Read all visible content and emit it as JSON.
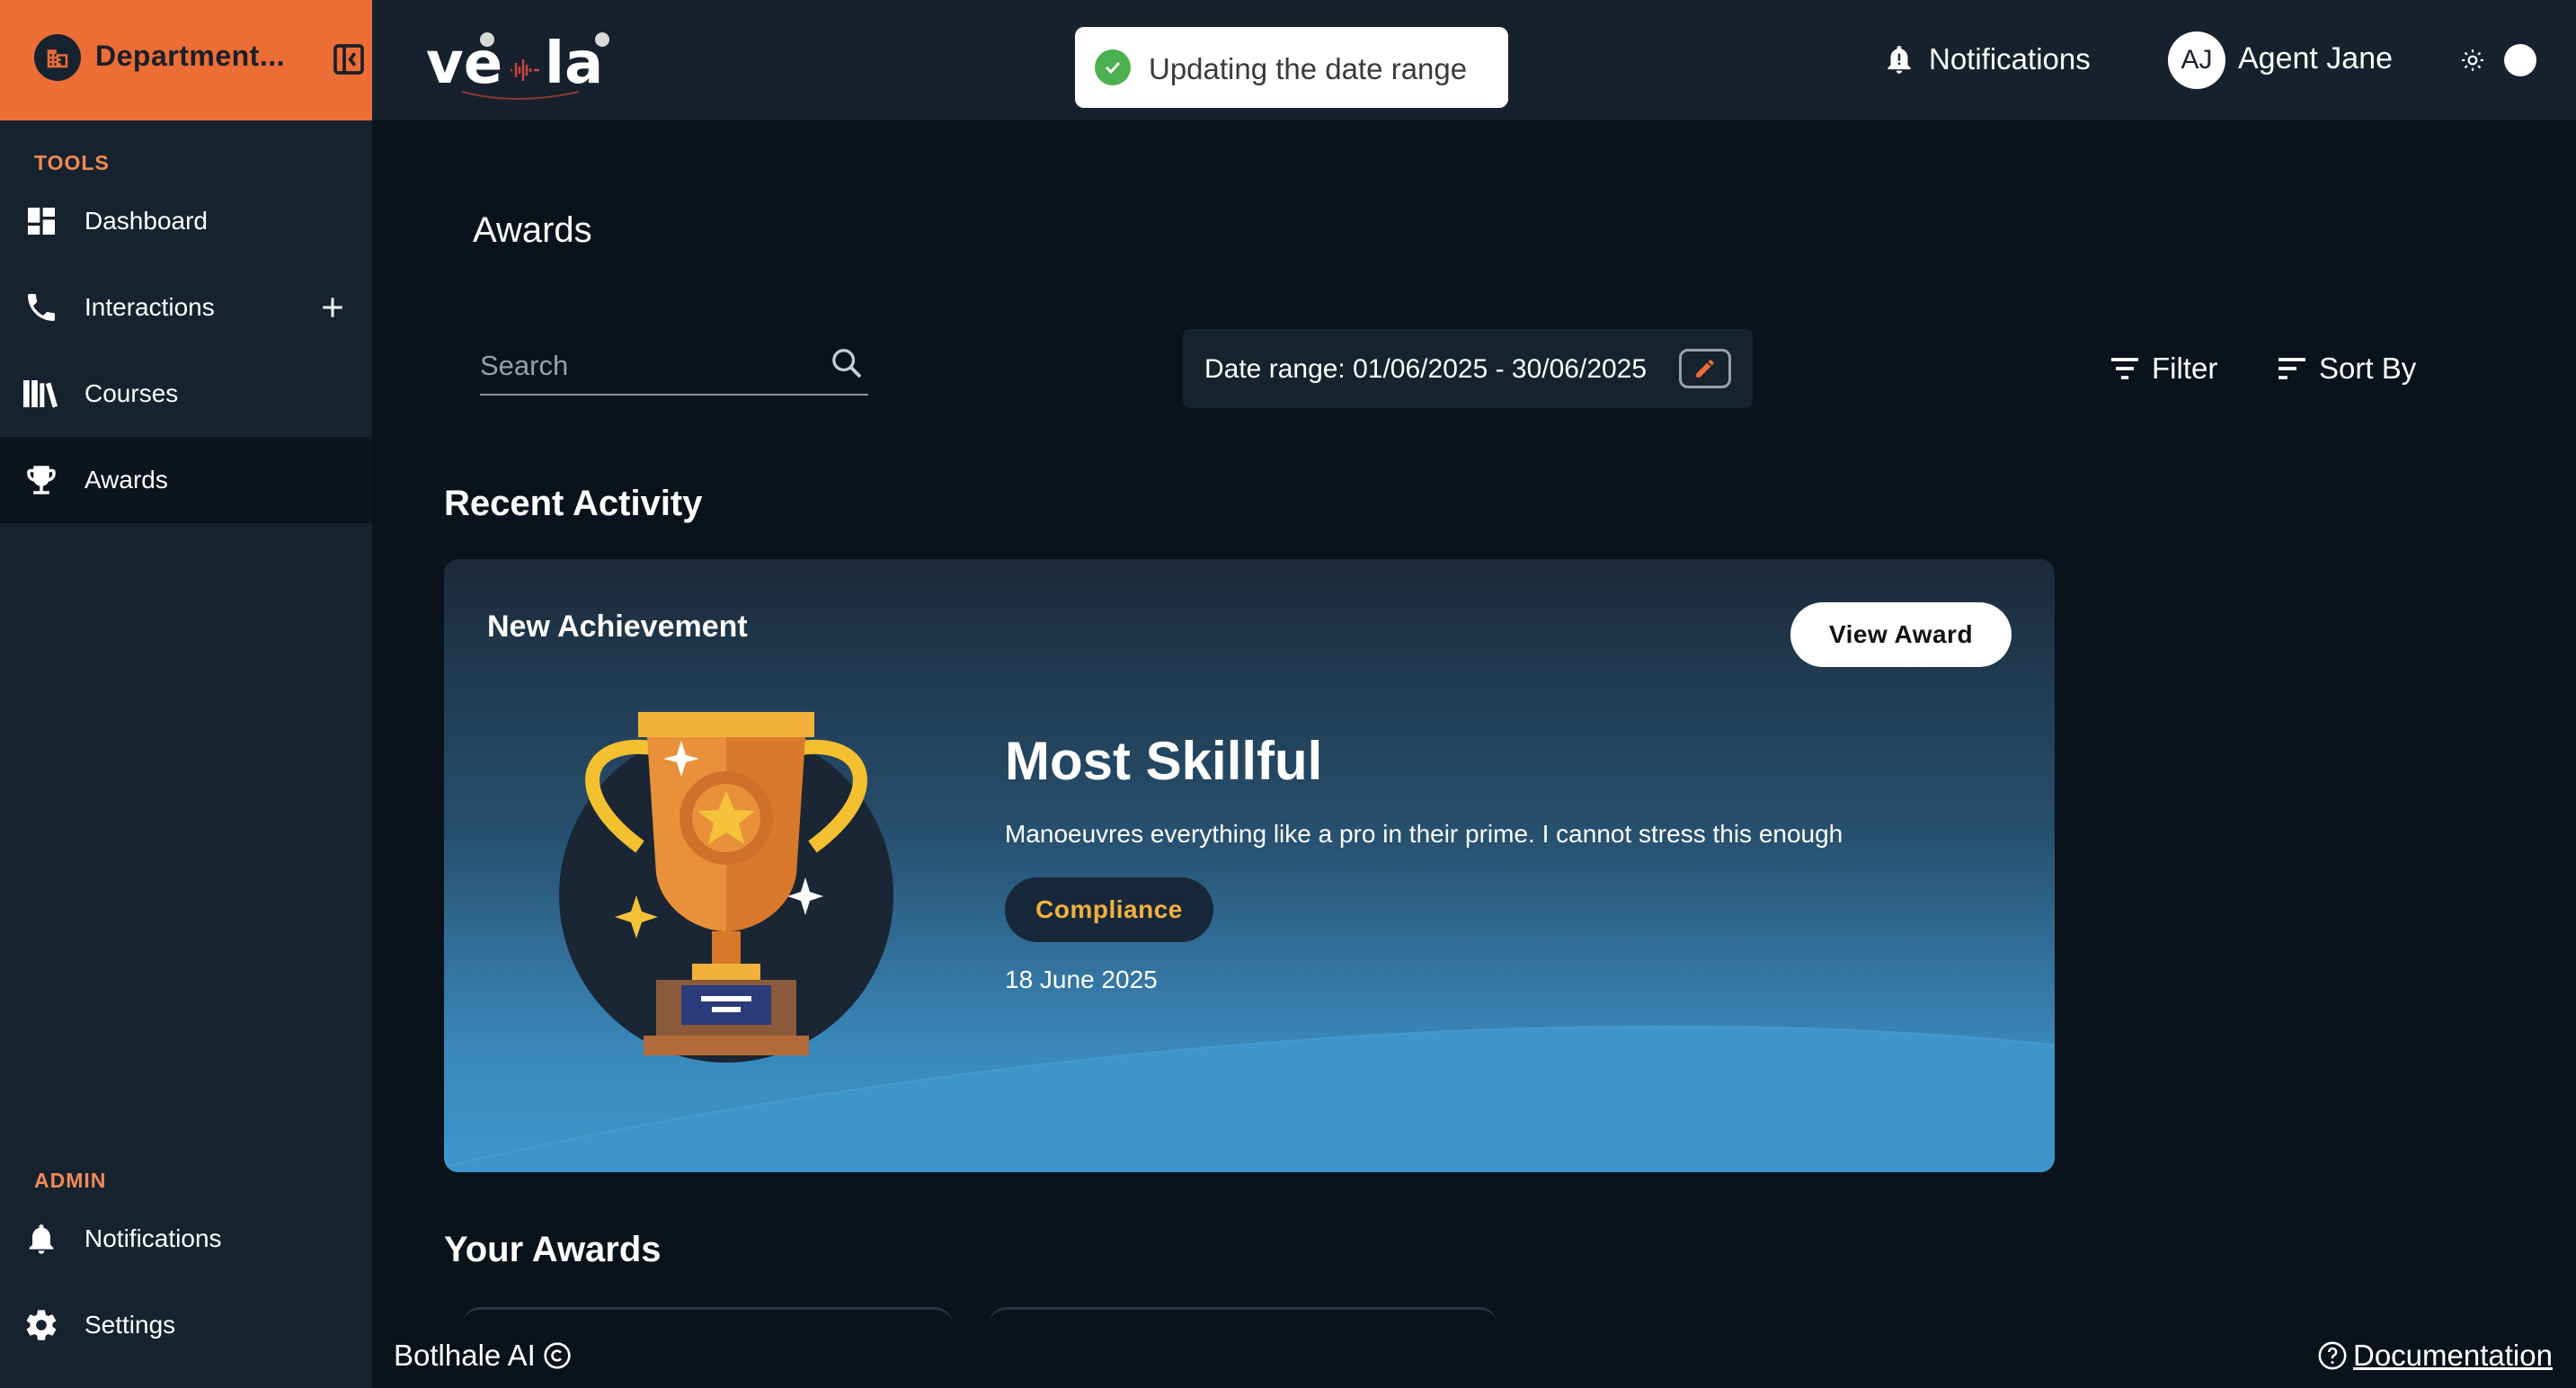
{
  "sidebar": {
    "department": "Department...",
    "sections": {
      "tools": "TOOLS",
      "admin": "ADMIN"
    },
    "tools": [
      {
        "label": "Dashboard",
        "icon": "dashboard-icon"
      },
      {
        "label": "Interactions",
        "icon": "phone-icon"
      },
      {
        "label": "Courses",
        "icon": "books-icon"
      },
      {
        "label": "Awards",
        "icon": "trophy-icon",
        "active": true
      }
    ],
    "admin": [
      {
        "label": "Notifications",
        "icon": "bell-icon"
      },
      {
        "label": "Settings",
        "icon": "gear-icon"
      }
    ]
  },
  "header": {
    "logo": "veela",
    "toast": "Updating the date range",
    "notifications_label": "Notifications",
    "avatar_initials": "AJ",
    "user_name": "Agent Jane"
  },
  "main": {
    "title": "Awards",
    "search_placeholder": "Search",
    "date_range": "Date range: 01/06/2025 - 30/06/2025",
    "filter_label": "Filter",
    "sort_label": "Sort By",
    "recent_heading": "Recent Activity",
    "your_awards_heading": "Your Awards"
  },
  "achievement": {
    "tag": "New Achievement",
    "view_button": "View Award",
    "title": "Most Skillful",
    "description": "Manoeuvres everything like a pro in their prime. I cannot stress this enough",
    "category": "Compliance",
    "date": "18 June 2025"
  },
  "footer": {
    "brand": "Botlhale AI",
    "documentation": "Documentation"
  },
  "colors": {
    "accent": "#ec6d36",
    "sidebar_bg": "#17222f",
    "page_bg": "#0a121b",
    "category_text": "#f3b23c",
    "success": "#4caf50"
  }
}
